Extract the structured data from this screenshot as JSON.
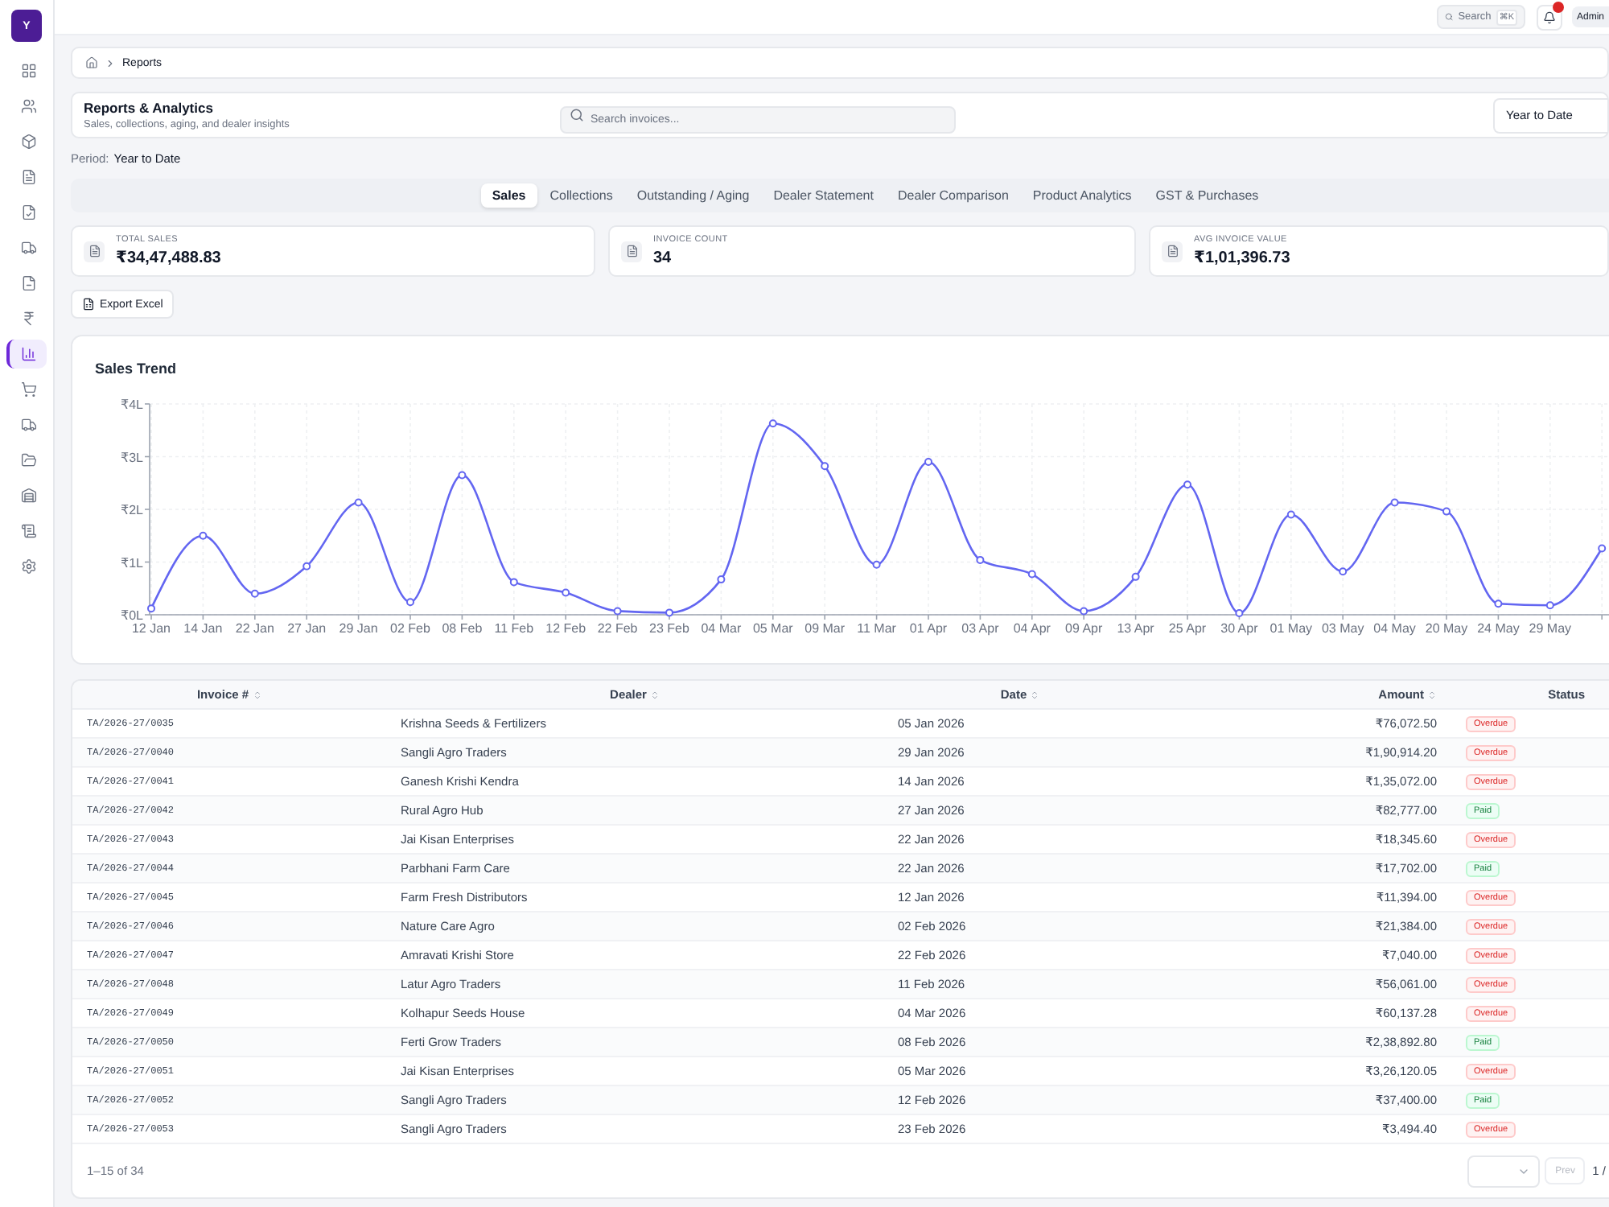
{
  "topbar": {
    "search": {
      "label": "Search",
      "shortcut": "⌘K"
    },
    "notifications": {
      "unread": true
    },
    "user": "Admin"
  },
  "sidebar": {
    "logo": "Y",
    "items": [
      {
        "selected": false
      },
      {
        "selected": false
      },
      {
        "selected": false
      },
      {
        "selected": false
      },
      {
        "selected": false
      },
      {
        "selected": false
      },
      {
        "selected": false
      },
      {
        "selected": false
      },
      {
        "selected": true
      },
      {
        "selected": false
      },
      {
        "selected": false
      },
      {
        "selected": false
      },
      {
        "selected": false
      },
      {
        "selected": false
      },
      {
        "selected": false
      }
    ]
  },
  "breadcrumb": {
    "current": "Reports"
  },
  "header": {
    "title": "Reports & Analytics",
    "subtitle": "Sales, collections, aging, and dealer insights",
    "search": {
      "placeholder": "Search invoices..."
    },
    "period_select": {
      "value": "Year to Date"
    }
  },
  "period": {
    "label": "Period:",
    "value": "Year to Date"
  },
  "tabs": [
    {
      "label": "Sales",
      "selected": true
    },
    {
      "label": "Collections",
      "selected": false
    },
    {
      "label": "Outstanding / Aging",
      "selected": false
    },
    {
      "label": "Dealer Statement",
      "selected": false
    },
    {
      "label": "Dealer Comparison",
      "selected": false
    },
    {
      "label": "Product Analytics",
      "selected": false
    },
    {
      "label": "GST & Purchases",
      "selected": false
    }
  ],
  "kpis": [
    {
      "label": "TOTAL SALES",
      "value": "₹34,47,488.83"
    },
    {
      "label": "INVOICE COUNT",
      "value": "34"
    },
    {
      "label": "AVG INVOICE VALUE",
      "value": "₹1,01,396.73"
    }
  ],
  "export_button": {
    "label": "Export Excel"
  },
  "sales_trend": {
    "title": "Sales Trend",
    "chart_data": {
      "type": "line",
      "categories": [
        "12 Jan",
        "14 Jan",
        "22 Jan",
        "27 Jan",
        "29 Jan",
        "02 Feb",
        "08 Feb",
        "11 Feb",
        "12 Feb",
        "22 Feb",
        "23 Feb",
        "04 Mar",
        "05 Mar",
        "09 Mar",
        "11 Mar",
        "01 Apr",
        "03 Apr",
        "04 Apr",
        "09 Apr",
        "13 Apr",
        "25 Apr",
        "30 Apr",
        "01 May",
        "03 May",
        "04 May",
        "20 May",
        "24 May",
        "29 May",
        null
      ],
      "values": [
        0.12,
        1.5,
        0.4,
        0.92,
        2.13,
        0.24,
        2.65,
        0.62,
        0.42,
        0.07,
        0.04,
        0.67,
        3.63,
        2.82,
        0.95,
        2.9,
        1.04,
        0.77,
        0.07,
        0.72,
        2.47,
        0.03,
        1.9,
        0.82,
        2.13,
        1.96,
        0.21,
        0.18,
        1.26
      ],
      "ylim": [
        0,
        4
      ],
      "yticks": [
        {
          "value": 0,
          "label": "₹0L"
        },
        {
          "value": 1,
          "label": "₹1L"
        },
        {
          "value": 2,
          "label": "₹2L"
        },
        {
          "value": 3,
          "label": "₹3L"
        },
        {
          "value": 4,
          "label": "₹4L"
        }
      ],
      "grid": true,
      "marker": true
    }
  },
  "table": {
    "columns": [
      {
        "label": "Invoice #",
        "sortable": true
      },
      {
        "label": "Dealer",
        "sortable": true
      },
      {
        "label": "Date",
        "sortable": true
      },
      {
        "label": "Amount",
        "sortable": true
      },
      {
        "label": "Status",
        "sortable": false
      }
    ],
    "rows": [
      {
        "invoice": "TA/2026-27/0035",
        "dealer": "Krishna Seeds & Fertilizers",
        "date": "05 Jan 2026",
        "amount": "₹76,072.50",
        "status": {
          "label": "Overdue",
          "kind": "overdue"
        }
      },
      {
        "invoice": "TA/2026-27/0040",
        "dealer": "Sangli Agro Traders",
        "date": "29 Jan 2026",
        "amount": "₹1,90,914.20",
        "status": {
          "label": "Overdue",
          "kind": "overdue"
        }
      },
      {
        "invoice": "TA/2026-27/0041",
        "dealer": "Ganesh Krishi Kendra",
        "date": "14 Jan 2026",
        "amount": "₹1,35,072.00",
        "status": {
          "label": "Overdue",
          "kind": "overdue"
        }
      },
      {
        "invoice": "TA/2026-27/0042",
        "dealer": "Rural Agro Hub",
        "date": "27 Jan 2026",
        "amount": "₹82,777.00",
        "status": {
          "label": "Paid",
          "kind": "paid"
        }
      },
      {
        "invoice": "TA/2026-27/0043",
        "dealer": "Jai Kisan Enterprises",
        "date": "22 Jan 2026",
        "amount": "₹18,345.60",
        "status": {
          "label": "Overdue",
          "kind": "overdue"
        }
      },
      {
        "invoice": "TA/2026-27/0044",
        "dealer": "Parbhani Farm Care",
        "date": "22 Jan 2026",
        "amount": "₹17,702.00",
        "status": {
          "label": "Paid",
          "kind": "paid"
        }
      },
      {
        "invoice": "TA/2026-27/0045",
        "dealer": "Farm Fresh Distributors",
        "date": "12 Jan 2026",
        "amount": "₹11,394.00",
        "status": {
          "label": "Overdue",
          "kind": "overdue"
        }
      },
      {
        "invoice": "TA/2026-27/0046",
        "dealer": "Nature Care Agro",
        "date": "02 Feb 2026",
        "amount": "₹21,384.00",
        "status": {
          "label": "Overdue",
          "kind": "overdue"
        }
      },
      {
        "invoice": "TA/2026-27/0047",
        "dealer": "Amravati Krishi Store",
        "date": "22 Feb 2026",
        "amount": "₹7,040.00",
        "status": {
          "label": "Overdue",
          "kind": "overdue"
        }
      },
      {
        "invoice": "TA/2026-27/0048",
        "dealer": "Latur Agro Traders",
        "date": "11 Feb 2026",
        "amount": "₹56,061.00",
        "status": {
          "label": "Overdue",
          "kind": "overdue"
        }
      },
      {
        "invoice": "TA/2026-27/0049",
        "dealer": "Kolhapur Seeds House",
        "date": "04 Mar 2026",
        "amount": "₹60,137.28",
        "status": {
          "label": "Overdue",
          "kind": "overdue"
        }
      },
      {
        "invoice": "TA/2026-27/0050",
        "dealer": "Ferti Grow Traders",
        "date": "08 Feb 2026",
        "amount": "₹2,38,892.80",
        "status": {
          "label": "Paid",
          "kind": "paid"
        }
      },
      {
        "invoice": "TA/2026-27/0051",
        "dealer": "Jai Kisan Enterprises",
        "date": "05 Mar 2026",
        "amount": "₹3,26,120.05",
        "status": {
          "label": "Overdue",
          "kind": "overdue"
        }
      },
      {
        "invoice": "TA/2026-27/0052",
        "dealer": "Sangli Agro Traders",
        "date": "12 Feb 2026",
        "amount": "₹37,400.00",
        "status": {
          "label": "Paid",
          "kind": "paid"
        }
      },
      {
        "invoice": "TA/2026-27/0053",
        "dealer": "Sangli Agro Traders",
        "date": "23 Feb 2026",
        "amount": "₹3,494.40",
        "status": {
          "label": "Overdue",
          "kind": "overdue"
        }
      }
    ]
  },
  "pagination": {
    "range": "1–15 of 34",
    "prev": {
      "label": "Prev",
      "disabled": true
    },
    "page": "1 /"
  }
}
